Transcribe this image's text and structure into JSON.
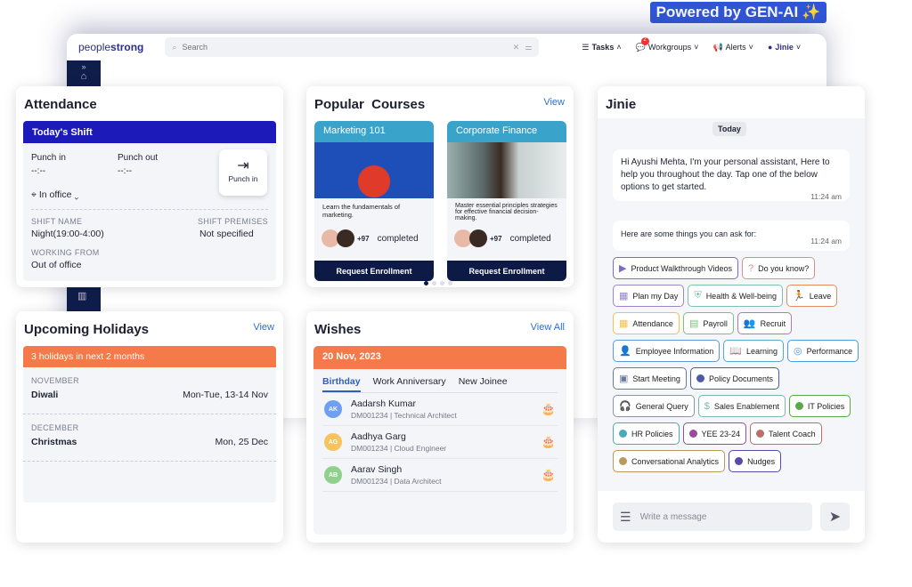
{
  "banner": "Powered by GEN-AI",
  "topbar": {
    "logo_light": "people",
    "logo_bold": "strong",
    "search_placeholder": "Search",
    "tasks": "Tasks",
    "workgroups": "Workgroups",
    "workgroups_badge": "2",
    "alerts": "Alerts",
    "jinie": "Jinie"
  },
  "attendance": {
    "title": "Attendance",
    "shift_header": "Today's Shift",
    "punch_in_label": "Punch in",
    "punch_in_value": "--:--",
    "punch_out_label": "Punch out",
    "punch_out_value": "--:--",
    "punch_button": "Punch in",
    "location": "In office",
    "shift_name_label": "SHIFT NAME",
    "shift_name": "Night(19:00-4:00)",
    "shift_premises_label": "SHIFT PREMISES",
    "shift_premises": "Not specified",
    "working_from_label": "WORKING FROM",
    "working_from": "Out of office"
  },
  "holidays": {
    "title": "Upcoming Holidays",
    "view": "View",
    "banner": "3 holidays in next 2 months",
    "items": [
      {
        "month": "NOVEMBER",
        "name": "Diwali",
        "date": "Mon-Tue, 13-14 Nov"
      },
      {
        "month": "DECEMBER",
        "name": "Christmas",
        "date": "Mon, 25 Dec"
      }
    ]
  },
  "courses": {
    "title": "Popular  Courses",
    "view": "View",
    "items": [
      {
        "name": "Marketing 101",
        "desc": "Learn the fundamentals of marketing.",
        "count": "+97",
        "completed": "completed",
        "button": "Request Enrollment"
      },
      {
        "name": "Corporate Finance",
        "desc": "Master essential principles strategies for effective financial decision-making.",
        "count": "+97",
        "completed": "completed",
        "button": "Request Enrollment"
      }
    ],
    "page_index": 0,
    "page_count": 4
  },
  "wishes": {
    "title": "Wishes",
    "view": "View All",
    "date": "20 Nov, 2023",
    "tabs": [
      "Birthday",
      "Work Anniversary",
      "New Joinee"
    ],
    "active_tab": "Birthday",
    "people": [
      {
        "initials": "AK",
        "name": "Aadarsh Kumar",
        "id": "DM001234",
        "role": "Technical Architect",
        "color": "#6e9ff0"
      },
      {
        "initials": "AG",
        "name": "Aadhya Garg",
        "id": "DM001234",
        "role": "Cloud Engineer",
        "color": "#f6c35e"
      },
      {
        "initials": "AB",
        "name": "Aarav Singh",
        "id": "DM001234",
        "role": "Data Architect",
        "color": "#8fd08f"
      }
    ]
  },
  "jinie": {
    "title": "Jinie",
    "day": "Today",
    "greeting": "Hi Ayushi Mehta, I'm your personal assistant, Here to help you throughout the day. Tap one of the below options to get started.",
    "greeting_time": "11:24 am",
    "prompt": "Here are some things you can ask for:",
    "prompt_time": "11:24 am",
    "input_placeholder": "Write a message",
    "chips": [
      {
        "label": "Product Walkthrough Videos",
        "icon": "▶",
        "color": "#7a6cc0"
      },
      {
        "label": "Do you know?",
        "icon": "?",
        "color": "#d9908a"
      },
      {
        "label": "Plan my Day",
        "icon": "▦",
        "color": "#9a86c8"
      },
      {
        "label": "Health & Well-being",
        "icon": "⛨",
        "color": "#7fbfb0"
      },
      {
        "label": "Leave",
        "icon": "🏃",
        "color": "#e88a60"
      },
      {
        "label": "Attendance",
        "icon": "▦",
        "color": "#f0c050"
      },
      {
        "label": "Payroll",
        "icon": "▤",
        "color": "#7cc07c"
      },
      {
        "label": "Recruit",
        "icon": "👥",
        "color": "#b07ab8"
      },
      {
        "label": "Employee Information",
        "icon": "👤",
        "color": "#5a9ad8"
      },
      {
        "label": "Learning",
        "icon": "📖",
        "color": "#5aa8c8"
      },
      {
        "label": "Performance",
        "icon": "◎",
        "color": "#4a9ae0"
      },
      {
        "label": "Start Meeting",
        "icon": "▣",
        "color": "#6a7a9a"
      },
      {
        "label": "Policy Documents",
        "dot": true,
        "color": "#4a5aa8"
      },
      {
        "label": "General Query",
        "icon": "🎧",
        "color": "#8a94a8"
      },
      {
        "label": "Sales Enablement",
        "icon": "$",
        "color": "#7ab8a8"
      },
      {
        "label": "IT Policies",
        "dot": true,
        "color": "#5aa84a"
      },
      {
        "label": "HR Policies",
        "dot": true,
        "color": "#4aaab8"
      },
      {
        "label": "YEE 23-24",
        "dot": true,
        "color": "#9a4a9a"
      },
      {
        "label": "Talent Coach",
        "dot": true,
        "color": "#b8706a"
      },
      {
        "label": "Conversational Analytics",
        "dot": true,
        "color": "#b89a5a"
      },
      {
        "label": "Nudges",
        "dot": true,
        "color": "#5a4aa8"
      }
    ]
  }
}
